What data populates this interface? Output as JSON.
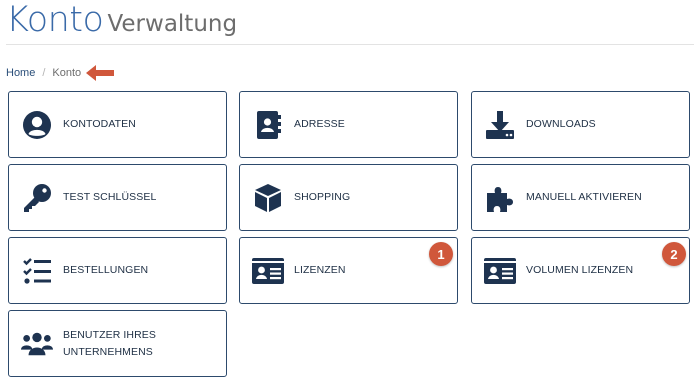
{
  "header": {
    "title_main": "Konto",
    "title_sub": "Verwaltung"
  },
  "breadcrumb": {
    "home": "Home",
    "separator": "/",
    "current": "Konto",
    "arrow_color": "#d0573b"
  },
  "colors": {
    "accent": "#3a6aa8",
    "icon": "#1e3350",
    "border": "#2d4a6c",
    "badge": "#d0573b"
  },
  "tiles": [
    {
      "label": "KONTODATEN",
      "icon": "user-circle-icon"
    },
    {
      "label": "ADRESSE",
      "icon": "address-book-icon"
    },
    {
      "label": "DOWNLOADS",
      "icon": "download-icon"
    },
    {
      "label": "TEST SCHLÜSSEL",
      "icon": "key-icon"
    },
    {
      "label": "SHOPPING",
      "icon": "box-icon"
    },
    {
      "label": "MANUELL AKTIVIEREN",
      "icon": "puzzle-icon"
    },
    {
      "label": "BESTELLUNGEN",
      "icon": "checklist-icon"
    },
    {
      "label": "LIZENZEN",
      "icon": "id-card-icon",
      "badge": "1"
    },
    {
      "label": "VOLUMEN LIZENZEN",
      "icon": "id-card-icon",
      "badge": "2"
    },
    {
      "label": "BENUTZER IHRES\nUNTERNEHMENS",
      "icon": "users-icon"
    }
  ]
}
